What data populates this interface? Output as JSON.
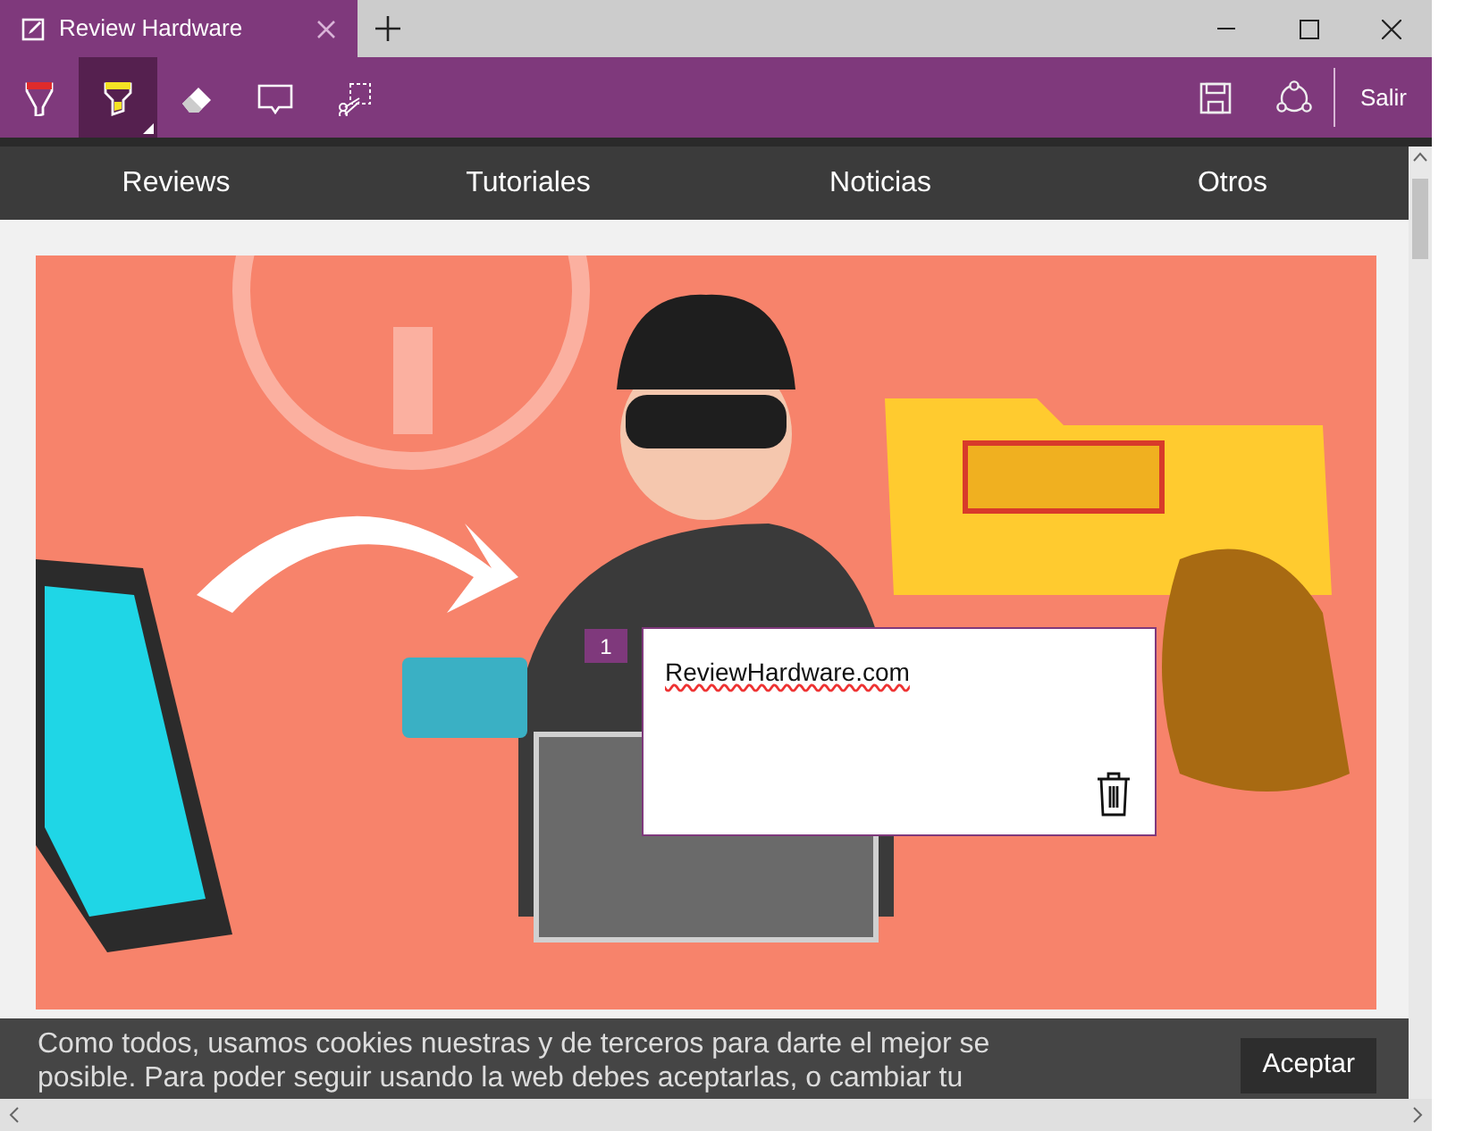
{
  "window": {
    "tab_title": "Review Hardware"
  },
  "toolbar": {
    "tools": [
      {
        "kind": "pen",
        "selected": false
      },
      {
        "kind": "highlighter",
        "selected": true
      },
      {
        "kind": "eraser",
        "selected": false
      },
      {
        "kind": "note",
        "selected": false
      },
      {
        "kind": "clip",
        "selected": false
      }
    ],
    "exit_label": "Salir"
  },
  "nav": [
    {
      "label": "Reviews"
    },
    {
      "label": "Tutoriales"
    },
    {
      "label": "Noticias"
    },
    {
      "label": "Otros"
    }
  ],
  "note": {
    "number": "1",
    "text": "ReviewHardware.com"
  },
  "cookie_bar": {
    "lines": [
      "Como todos, usamos cookies nuestras y de terceros para darte el mejor se",
      "posible. Para poder seguir usando la web debes aceptarlas, o cambiar tu"
    ],
    "button": "Aceptar"
  }
}
